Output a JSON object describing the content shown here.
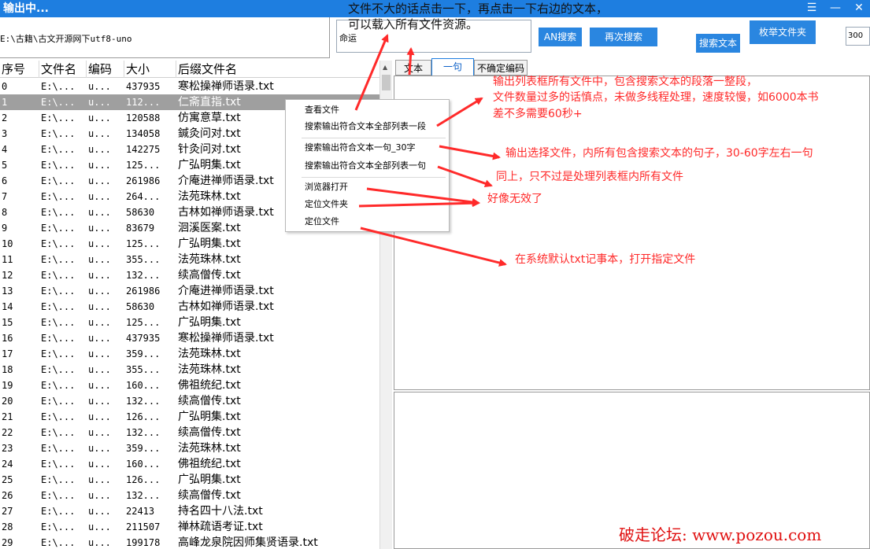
{
  "window": {
    "title": "输出中...",
    "menu_icon": "hamburger-icon",
    "minimize_icon": "minimize-icon",
    "close_icon": "close-icon"
  },
  "toolbar": {
    "path": "E:\\古籍\\古文开源网下utf8-uno",
    "search_text": "命运",
    "an_search_label": "AN搜索",
    "research_label": "再次搜索",
    "search_text_label": "搜索文本",
    "folder_label": "枚举文件夹",
    "count_value": "300"
  },
  "table": {
    "columns": [
      "序号",
      "文件名",
      "编码",
      "大小",
      "后缀文件名"
    ],
    "selected_index": 1,
    "rows": [
      [
        "0",
        "E:\\...",
        "u...",
        "437935",
        "寒松操禅师语录.txt"
      ],
      [
        "1",
        "E:\\...",
        "u...",
        "112...",
        "仁斋直指.txt"
      ],
      [
        "2",
        "E:\\...",
        "u...",
        "120588",
        "仿寓意草.txt"
      ],
      [
        "3",
        "E:\\...",
        "u...",
        "134058",
        "鍼灸问对.txt"
      ],
      [
        "4",
        "E:\\...",
        "u...",
        "142275",
        "针灸问对.txt"
      ],
      [
        "5",
        "E:\\...",
        "u...",
        "125...",
        "广弘明集.txt"
      ],
      [
        "6",
        "E:\\...",
        "u...",
        "261986",
        "介庵进禅师语录.txt"
      ],
      [
        "7",
        "E:\\...",
        "u...",
        "264...",
        "法苑珠林.txt"
      ],
      [
        "8",
        "E:\\...",
        "u...",
        "58630",
        "古林如禅师语录.txt"
      ],
      [
        "9",
        "E:\\...",
        "u...",
        "83679",
        "洄溪医案.txt"
      ],
      [
        "10",
        "E:\\...",
        "u...",
        "125...",
        "广弘明集.txt"
      ],
      [
        "11",
        "E:\\...",
        "u...",
        "355...",
        "法苑珠林.txt"
      ],
      [
        "12",
        "E:\\...",
        "u...",
        "132...",
        "续高僧传.txt"
      ],
      [
        "13",
        "E:\\...",
        "u...",
        "261986",
        "介庵进禅师语录.txt"
      ],
      [
        "14",
        "E:\\...",
        "u...",
        "58630",
        "古林如禅师语录.txt"
      ],
      [
        "15",
        "E:\\...",
        "u...",
        "125...",
        "广弘明集.txt"
      ],
      [
        "16",
        "E:\\...",
        "u...",
        "437935",
        "寒松操禅师语录.txt"
      ],
      [
        "17",
        "E:\\...",
        "u...",
        "359...",
        "法苑珠林.txt"
      ],
      [
        "18",
        "E:\\...",
        "u...",
        "355...",
        "法苑珠林.txt"
      ],
      [
        "19",
        "E:\\...",
        "u...",
        "160...",
        "佛祖统纪.txt"
      ],
      [
        "20",
        "E:\\...",
        "u...",
        "132...",
        "续高僧传.txt"
      ],
      [
        "21",
        "E:\\...",
        "u...",
        "126...",
        "广弘明集.txt"
      ],
      [
        "22",
        "E:\\...",
        "u...",
        "132...",
        "续高僧传.txt"
      ],
      [
        "23",
        "E:\\...",
        "u...",
        "359...",
        "法苑珠林.txt"
      ],
      [
        "24",
        "E:\\...",
        "u...",
        "160...",
        "佛祖统纪.txt"
      ],
      [
        "25",
        "E:\\...",
        "u...",
        "126...",
        "广弘明集.txt"
      ],
      [
        "26",
        "E:\\...",
        "u...",
        "132...",
        "续高僧传.txt"
      ],
      [
        "27",
        "E:\\...",
        "u...",
        "22413",
        "持名四十八法.txt"
      ],
      [
        "28",
        "E:\\...",
        "u...",
        "211507",
        "禅林疏语考证.txt"
      ],
      [
        "29",
        "E:\\...",
        "u...",
        "199178",
        "高峰龙泉院因师集贤语录.txt"
      ]
    ]
  },
  "tabs": [
    "文本",
    "一句",
    "不确定编码"
  ],
  "active_tab": 1,
  "context_menu": [
    "查看文件",
    "搜索输出符合文本全部列表一段",
    "搜索输出符合文本一句_30字",
    "搜索输出符合文本全部列表一句",
    "浏览器打开",
    "定位文件夹",
    "定位文件"
  ],
  "annotations": {
    "top_line1": "文件不大的话点击一下，再点击一下右边的文本，",
    "top_line2": "可以载入所有文件资源。",
    "note1_line1": "输出列表框所有文件中，包含搜索文本的段落一整段，",
    "note1_line2": "文件数量过多的话慎点，未做多线程处理，速度较慢，如6000本书",
    "note1_line3": "差不多需要60秒+",
    "note2": "输出选择文件，内所有包含搜索文本的句子，30-60字左右一句",
    "note3": "同上，只不过是处理列表框内所有文件",
    "note4": "好像无效了",
    "note5": "在系统默认txt记事本，打开指定文件",
    "arrow_color": "#ff2a2a"
  },
  "watermark": "破走论坛: www.pozou.com",
  "colors": {
    "titlebar": "#1e7ee0",
    "button": "#2a86e0",
    "selected_row": "#9f9f9f",
    "annotation": "#ff2a2a"
  }
}
